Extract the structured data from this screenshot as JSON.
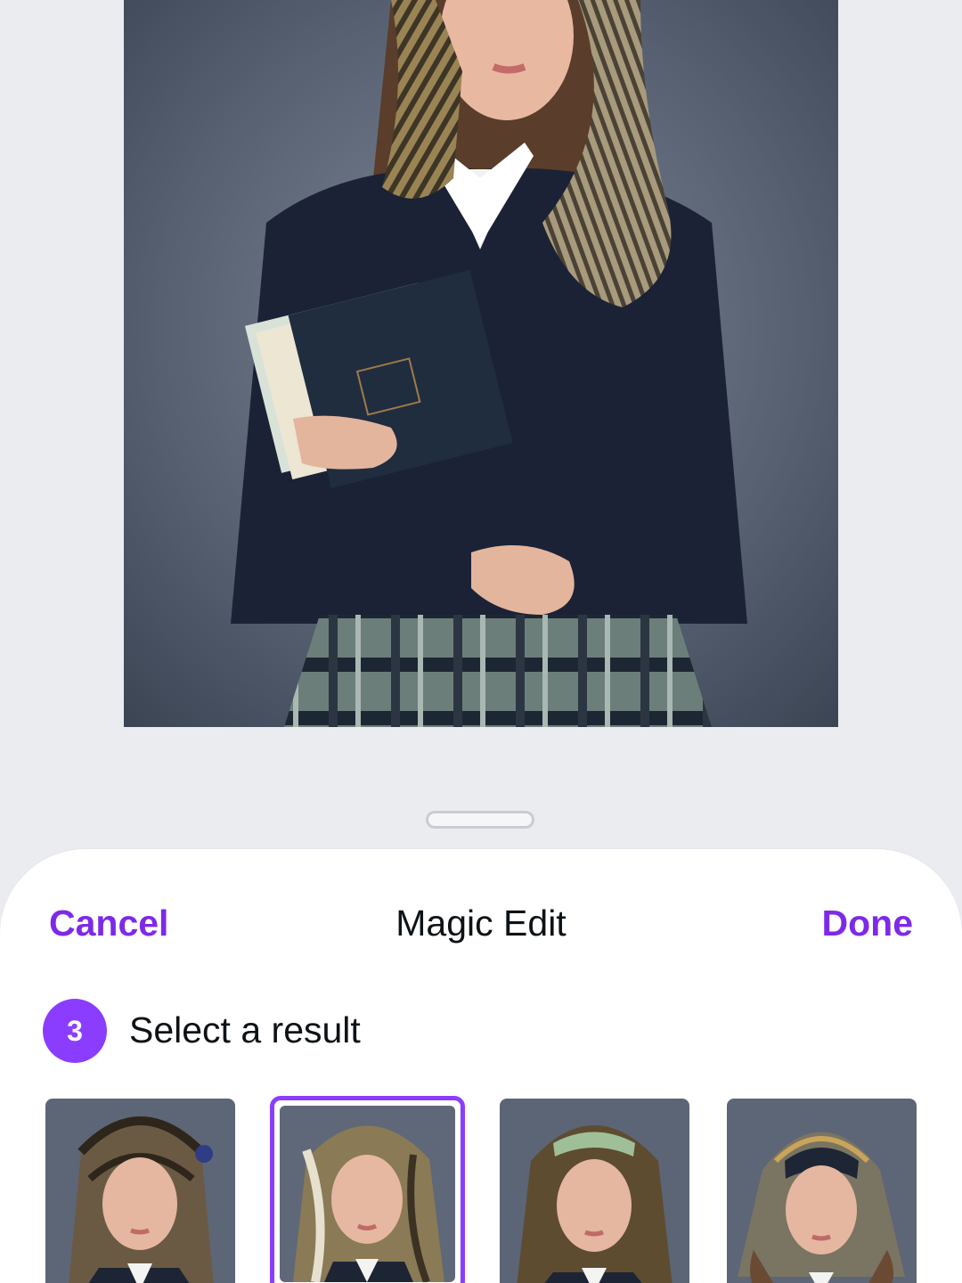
{
  "sheet": {
    "cancel_label": "Cancel",
    "title": "Magic Edit",
    "done_label": "Done"
  },
  "step": {
    "number": "3",
    "label": "Select a result"
  },
  "results": [
    {
      "id": "result-1",
      "selected": false,
      "scarf_color": "#6b5a43"
    },
    {
      "id": "result-2",
      "selected": true,
      "scarf_color": "#8a7a55"
    },
    {
      "id": "result-3",
      "selected": false,
      "scarf_color": "#5e4c30"
    },
    {
      "id": "result-4",
      "selected": false,
      "scarf_color": "#7a7462"
    }
  ],
  "colors": {
    "accent": "#8b3dff",
    "accent_text": "#7d2ae8",
    "background": "#eaecf0",
    "sheet": "#ffffff"
  },
  "icons": {
    "drag_handle": "drag-handle"
  }
}
